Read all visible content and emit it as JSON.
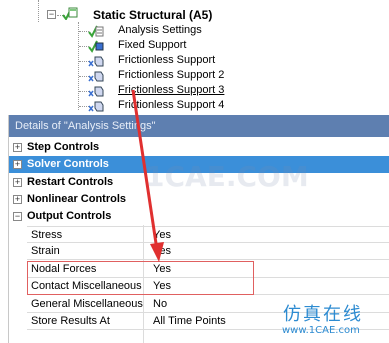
{
  "tree": {
    "root_label": "Static Structural (A5)",
    "items": [
      {
        "label": "Analysis Settings",
        "icon": "analysis-settings-icon"
      },
      {
        "label": "Fixed Support",
        "icon": "fixed-support-icon"
      },
      {
        "label": "Frictionless Support",
        "icon": "frictionless-support-icon"
      },
      {
        "label": "Frictionless Support 2",
        "icon": "frictionless-support-icon"
      },
      {
        "label": "Frictionless Support 3",
        "icon": "frictionless-support-icon"
      },
      {
        "label": "Frictionless Support 4",
        "icon": "frictionless-support-icon"
      }
    ]
  },
  "details": {
    "title": "Details of \"Analysis Settings\"",
    "groups": [
      {
        "label": "Step Controls",
        "toggle": "+"
      },
      {
        "label": "Solver Controls",
        "toggle": "+"
      },
      {
        "label": "Restart Controls",
        "toggle": "+"
      },
      {
        "label": "Nonlinear Controls",
        "toggle": "+"
      },
      {
        "label": "Output Controls",
        "toggle": "−"
      }
    ],
    "output_controls": [
      {
        "name": "Stress",
        "value": "Yes"
      },
      {
        "name": "Strain",
        "value": "Yes"
      },
      {
        "name": "Nodal Forces",
        "value": "Yes"
      },
      {
        "name": "Contact Miscellaneous",
        "value": "Yes"
      },
      {
        "name": "General Miscellaneous",
        "value": "No"
      },
      {
        "name": "Store Results At",
        "value": "All Time Points"
      }
    ]
  },
  "watermark": {
    "center": "1CAE.COM",
    "brand_cn": "仿真在线",
    "url": "www.1CAE.com"
  },
  "colors": {
    "title_bar": "#5e7fb0",
    "selected_row": "#3b8fd9",
    "highlight_box": "#e06060",
    "arrow": "#e03030",
    "watermark_blue": "#2d8bd1"
  }
}
